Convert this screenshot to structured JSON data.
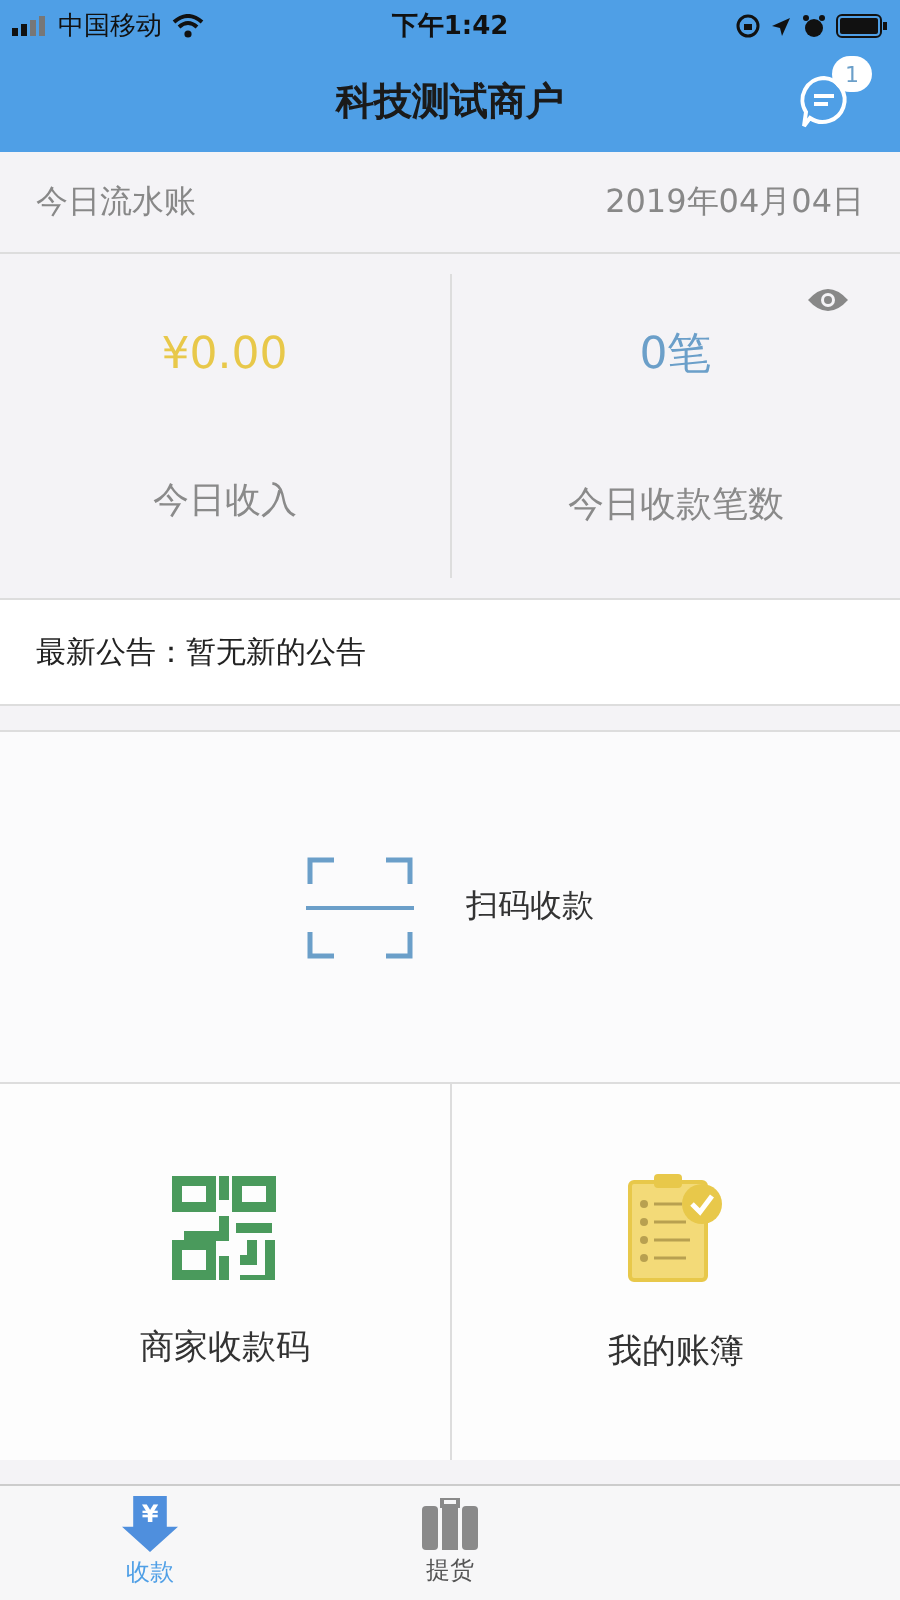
{
  "status_bar": {
    "carrier": "中国移动",
    "time": "下午1:42"
  },
  "header": {
    "title": "科技测试商户",
    "message_badge": "1"
  },
  "ledger": {
    "title": "今日流水账",
    "date": "2019年04月04日"
  },
  "stats": [
    {
      "value": "¥0.00",
      "label": "今日收入",
      "color": "#e8c84a"
    },
    {
      "value": "0笔",
      "label": "今日收款笔数",
      "color": "#6b9fc9"
    }
  ],
  "notice": {
    "label": "最新公告：",
    "text": "暂无新的公告"
  },
  "scan": {
    "label": "扫码收款"
  },
  "tiles": [
    {
      "kind": "qr",
      "label": "商家收款码"
    },
    {
      "kind": "ledger",
      "label": "我的账簿"
    }
  ],
  "tabs": [
    {
      "kind": "yen",
      "glyph": "¥",
      "label": "收款",
      "selected": true
    },
    {
      "kind": "goods",
      "label": "提货",
      "selected": false
    }
  ]
}
